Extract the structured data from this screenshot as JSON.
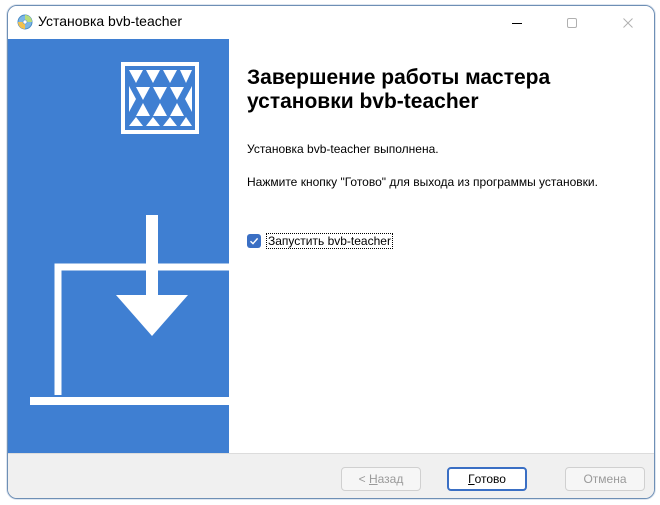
{
  "window": {
    "title": "Установка bvb-teacher",
    "minimize_glyph": "—",
    "maximize_glyph": "☐",
    "close_glyph": "✕"
  },
  "content": {
    "heading": "Завершение работы мастера установки bvb-teacher",
    "message_done": "Установка bvb-teacher выполнена.",
    "message_hint": "Нажмите кнопку \"Готово\" для выхода из программы установки.",
    "launch_checkbox": {
      "label": "Запустить bvb-teacher",
      "checked": true
    }
  },
  "buttons": {
    "back_prefix": "< ",
    "back_accel": "Н",
    "back_rest": "азад",
    "finish_accel": "Г",
    "finish_rest": "отово",
    "cancel_label": "Отмена"
  },
  "colors": {
    "banner_blue": "#3f7fd2",
    "checkbox_blue": "#3a6fc4",
    "banner_art": "#ffffff"
  },
  "icons": {
    "app": "installer-disc-icon",
    "banner_logo": "triangle-pattern-logo",
    "banner_art": "laptop-download-icon",
    "checkbox": "checkmark-icon"
  }
}
